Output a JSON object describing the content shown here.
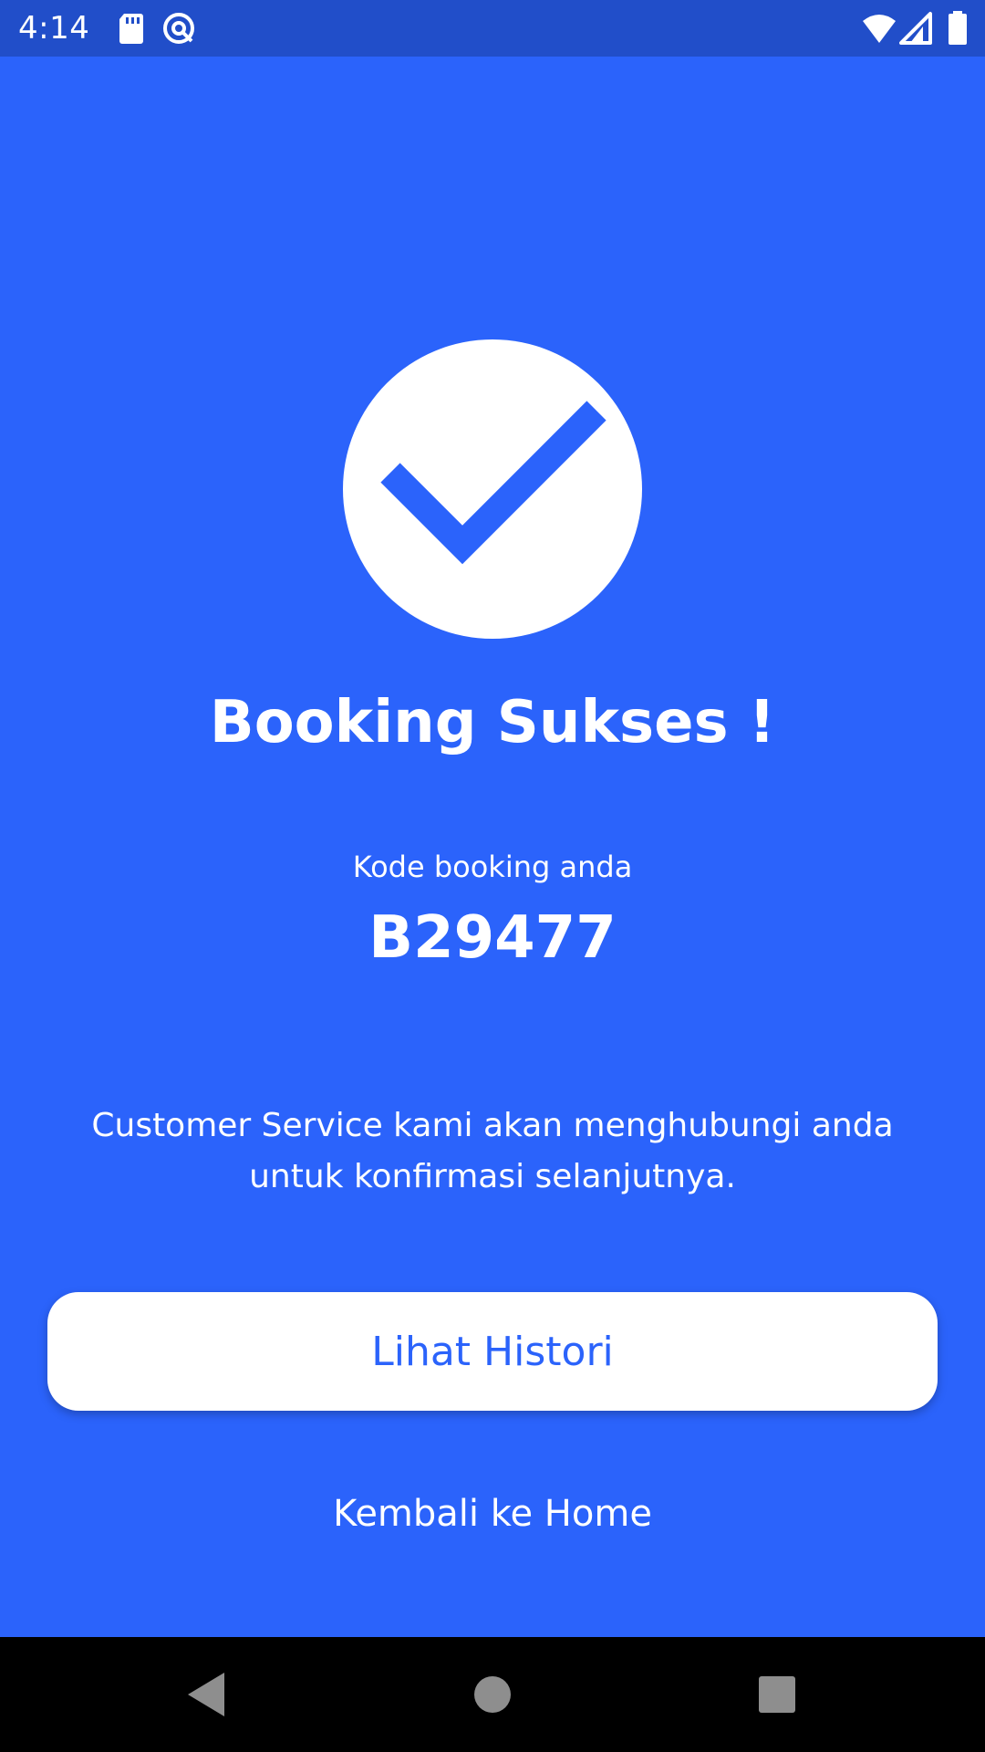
{
  "status_bar": {
    "time": "4:14",
    "icons": [
      "sd-card-icon",
      "sync-icon",
      "wifi-icon",
      "signal-icon",
      "battery-icon"
    ]
  },
  "main": {
    "check_icon": "check-icon",
    "title": "Booking Sukses !",
    "booking_code_label": "Kode booking anda",
    "booking_code": "B29477",
    "message": "Customer Service kami akan menghubungi anda untuk konfirmasi selanjutnya.",
    "history_button_label": "Lihat Histori",
    "home_link_label": "Kembali ke Home"
  },
  "nav_bar": {
    "icons": [
      "back-icon",
      "home-icon",
      "recents-icon"
    ]
  },
  "colors": {
    "background": "#2b63fb",
    "status_bar": "#214ec9",
    "nav_bar": "#000000",
    "button_background": "#ffffff",
    "accent": "#2b63fb"
  }
}
